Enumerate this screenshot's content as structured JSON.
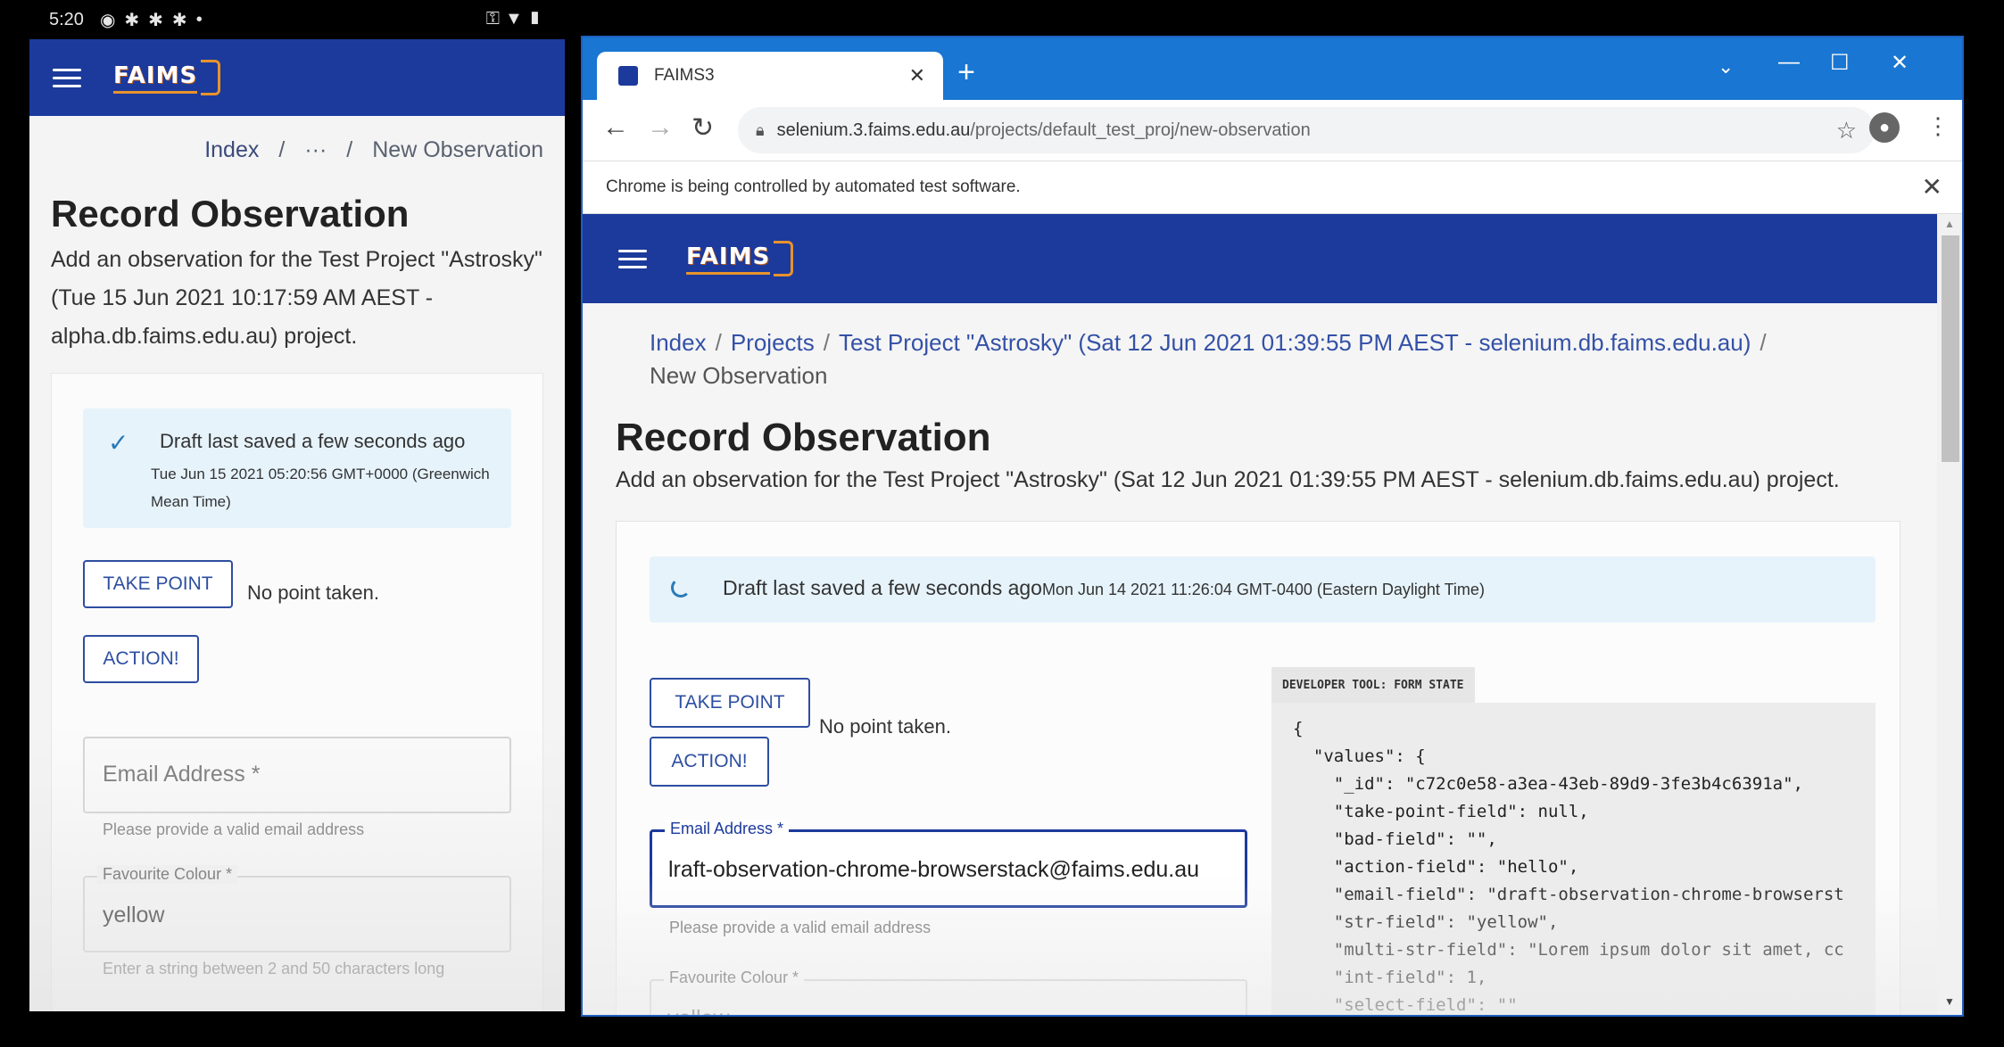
{
  "phone": {
    "status": {
      "time": "5:20"
    },
    "logo": "FAIMS",
    "breadcrumb": {
      "index": "Index",
      "sep": "/",
      "ellipsis": "···",
      "current": "New Observation"
    },
    "title": "Record Observation",
    "description": "Add an observation for the Test Project \"Astrosky\" (Tue 15 Jun 2021 10:17:59 AM AEST - alpha.db.faims.edu.au) project.",
    "alert": {
      "title": "Draft last saved a few seconds ago",
      "timestamp": "Tue Jun 15 2021 05:20:56 GMT+0000 (Greenwich Mean Time)"
    },
    "take_point": "TAKE POINT",
    "no_point": "No point taken.",
    "action": "ACTION!",
    "email": {
      "label": "Email Address *",
      "helper": "Please provide a valid email address"
    },
    "colour": {
      "label": "Favourite Colour *",
      "value": "yellow",
      "helper": "Enter a string between 2 and 50 characters long"
    }
  },
  "browser": {
    "tab": {
      "title": "FAIMS3",
      "close": "✕"
    },
    "new_tab": "+",
    "window_controls": {
      "minimize": "—",
      "maximize": "☐",
      "close": "✕"
    },
    "url": {
      "host": "selenium.3.faims.edu.au",
      "path": "/projects/default_test_proj/new-observation"
    },
    "infobar": {
      "message": "Chrome is being controlled by automated test software.",
      "close": "✕"
    },
    "app": {
      "logo": "FAIMS",
      "breadcrumb": {
        "index": "Index",
        "projects": "Projects",
        "project": "Test Project \"Astrosky\" (Sat 12 Jun 2021 01:39:55 PM AEST - selenium.db.faims.edu.au)",
        "current": "New Observation",
        "sep": "/"
      },
      "title": "Record Observation",
      "description": "Add an observation for the Test Project \"Astrosky\" (Sat 12 Jun 2021 01:39:55 PM AEST - selenium.db.faims.edu.au) project.",
      "alert": {
        "title": "Draft last saved a few seconds ago",
        "timestamp": "Mon Jun 14 2021 11:26:04 GMT-0400 (Eastern Daylight Time)"
      },
      "take_point": "TAKE POINT",
      "no_point": "No point taken.",
      "action": "ACTION!",
      "email": {
        "label": "Email Address *",
        "value": "lraft-observation-chrome-browserstack@faims.edu.au",
        "helper": "Please provide a valid email address"
      },
      "colour": {
        "label": "Favourite Colour *",
        "value": "yellow"
      },
      "dev_tool": {
        "tab": "DEVELOPER TOOL: FORM STATE",
        "json": "{\n  \"values\": {\n    \"_id\": \"c72c0e58-a3ea-43eb-89d9-3fe3b4c6391a\",\n    \"take-point-field\": null,\n    \"bad-field\": \"\",\n    \"action-field\": \"hello\",\n    \"email-field\": \"draft-observation-chrome-browserst\n    \"str-field\": \"yellow\",\n    \"multi-str-field\": \"Lorem ipsum dolor sit amet, cc\n    \"int-field\": 1,\n    \"select-field\": \"\""
      }
    }
  },
  "colors": {
    "app_bar": "#1c3a9c",
    "chrome_titlebar": "#1976d2",
    "alert_bg": "#e6f3fb",
    "accent": "#2d4ea1"
  }
}
